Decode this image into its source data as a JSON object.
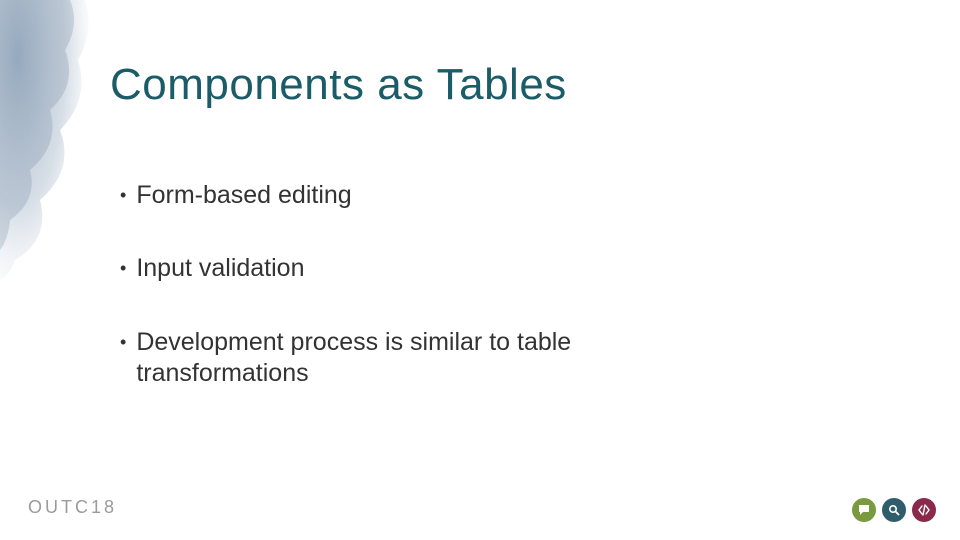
{
  "title": "Components as Tables",
  "bullets": [
    "Form-based editing",
    "Input validation",
    "Development process is similar to table transformations"
  ],
  "footer": {
    "logo": "OUTC18"
  },
  "colors": {
    "title": "#1a5c68",
    "text": "#333333",
    "footer_logo": "#9b9b9b",
    "icon_chat": "#7a9a3f",
    "icon_search": "#2f5d6a",
    "icon_code": "#8a2a4a"
  },
  "icons": {
    "chat": "speech-bubble-icon",
    "search": "magnifier-icon",
    "code": "code-brackets-icon"
  }
}
